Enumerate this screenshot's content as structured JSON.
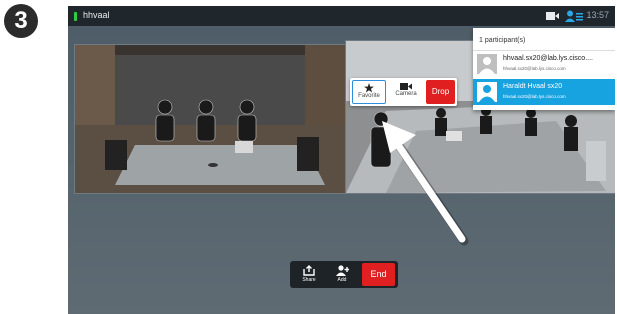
{
  "step": {
    "number": "3"
  },
  "header": {
    "participant_name": "hhvaal",
    "time": "13:57"
  },
  "icons": {
    "camera_status": "camera-icon",
    "participants": "participants-icon",
    "favorite": "star-icon",
    "camera": "video-camera-icon",
    "share": "share-icon",
    "add": "add-person-icon"
  },
  "video_context_menu": {
    "favorite_label": "Favorite",
    "camera_label": "Camera",
    "drop_label": "Drop"
  },
  "participants_panel": {
    "header": "1 participant(s)",
    "items": [
      {
        "name": "hhvaal.sx20@lab.lys.cisco....",
        "address": "hhvaal.sx20@lab.lys.cisco.com",
        "selected": false
      },
      {
        "name": "Haraldt Hvaal sx20",
        "address": "hhvaal.sx20@lab.lys.cisco.com",
        "selected": true
      }
    ]
  },
  "call_controls": {
    "share_label": "Share",
    "add_label": "Add",
    "end_label": "End"
  },
  "colors": {
    "end_button": "#e02020",
    "selected_row": "#17a2e0",
    "status_dot": "#2ecc40"
  }
}
